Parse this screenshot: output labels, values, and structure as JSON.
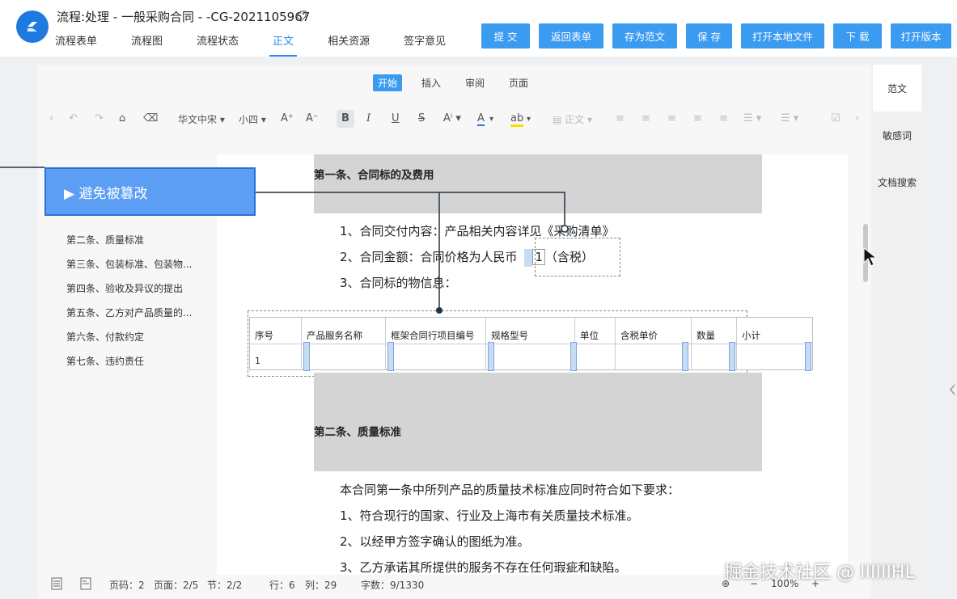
{
  "header": {
    "title": "流程:处理 - 一般采购合同 - -CG-2021105967",
    "tabs": [
      "流程表单",
      "流程图",
      "流程状态",
      "正文",
      "相关资源",
      "签字意见"
    ],
    "active_tab": "正文",
    "buttons": [
      "提 交",
      "返回表单",
      "存为范文",
      "保 存",
      "打开本地文件",
      "下 载",
      "打开版本"
    ]
  },
  "ribbon": {
    "tabs": [
      "开始",
      "插入",
      "审阅",
      "页面"
    ],
    "active_tab": "开始"
  },
  "toolbar": {
    "font_name": "华文中宋",
    "font_size": "小四",
    "style_name": "正文"
  },
  "outline": {
    "items": [
      "第二条、质量标准",
      "第三条、包装标准、包装物...",
      "第四条、验收及异议的提出",
      "第五条、乙方对产品质量的...",
      "第六条、付款约定",
      "第七条、违约责任"
    ]
  },
  "document": {
    "clause1_title": "第一条、合同标的及费用",
    "line1": "1、合同交付内容：产品相关内容详见《采购清单》",
    "line2_prefix": "2、合同金额：合同价格为人民币",
    "line2_value": "1",
    "line2_suffix": "（含税）",
    "line3": "3、合同标的物信息：",
    "table_headers": [
      "序号",
      "产品服务名称",
      "框架合同行项目编号",
      "规格型号",
      "单位",
      "含税单价",
      "数量",
      "小计"
    ],
    "table_row": [
      "1",
      "",
      "",
      "",
      "",
      "",
      "",
      ""
    ],
    "clause2_title": "第二条、质量标准",
    "q_intro": "本合同第一条中所列产品的质量技术标准应同时符合如下要求：",
    "q1": "1、符合现行的国家、行业及上海市有关质量技术标准。",
    "q2": "2、以经甲方签字确认的图纸为准。",
    "q3": "3、乙方承诺其所提供的服务不存在任何瑕疵和缺陷。"
  },
  "side_panel": {
    "items": [
      "范文",
      "敏感词",
      "文档搜索"
    ],
    "active": "范文"
  },
  "status": {
    "page_code": "页码：2",
    "page": "页面：2/5",
    "section": "节：2/2",
    "row": "行：6",
    "col": "列：29",
    "words": "字数：9/1330",
    "zoom": "100%"
  },
  "annotation": {
    "label": "▶ 避免被篡改"
  },
  "watermark": "掘金技术社区 @ IIIIIIHL",
  "colors": {
    "accent": "#3a9bf0",
    "annotation": "#5b9ef4",
    "band": "#d4d4d5"
  }
}
